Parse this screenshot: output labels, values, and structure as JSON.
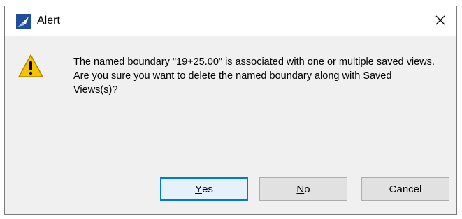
{
  "window": {
    "title": "Alert",
    "app_icon": "app-logo-icon",
    "close_icon": "close-icon"
  },
  "content": {
    "icon": "warning-icon",
    "message": "The named boundary \"19+25.00\" is associated with one or multiple saved views. Are you sure you want to delete the named boundary along with Saved Views(s)?"
  },
  "buttons": {
    "yes": {
      "access_key": "Y",
      "rest": "es"
    },
    "no": {
      "access_key": "N",
      "rest": "o"
    },
    "cancel": {
      "label": "Cancel"
    }
  },
  "colors": {
    "accent": "#0078d7",
    "warning": "#f5c400"
  }
}
